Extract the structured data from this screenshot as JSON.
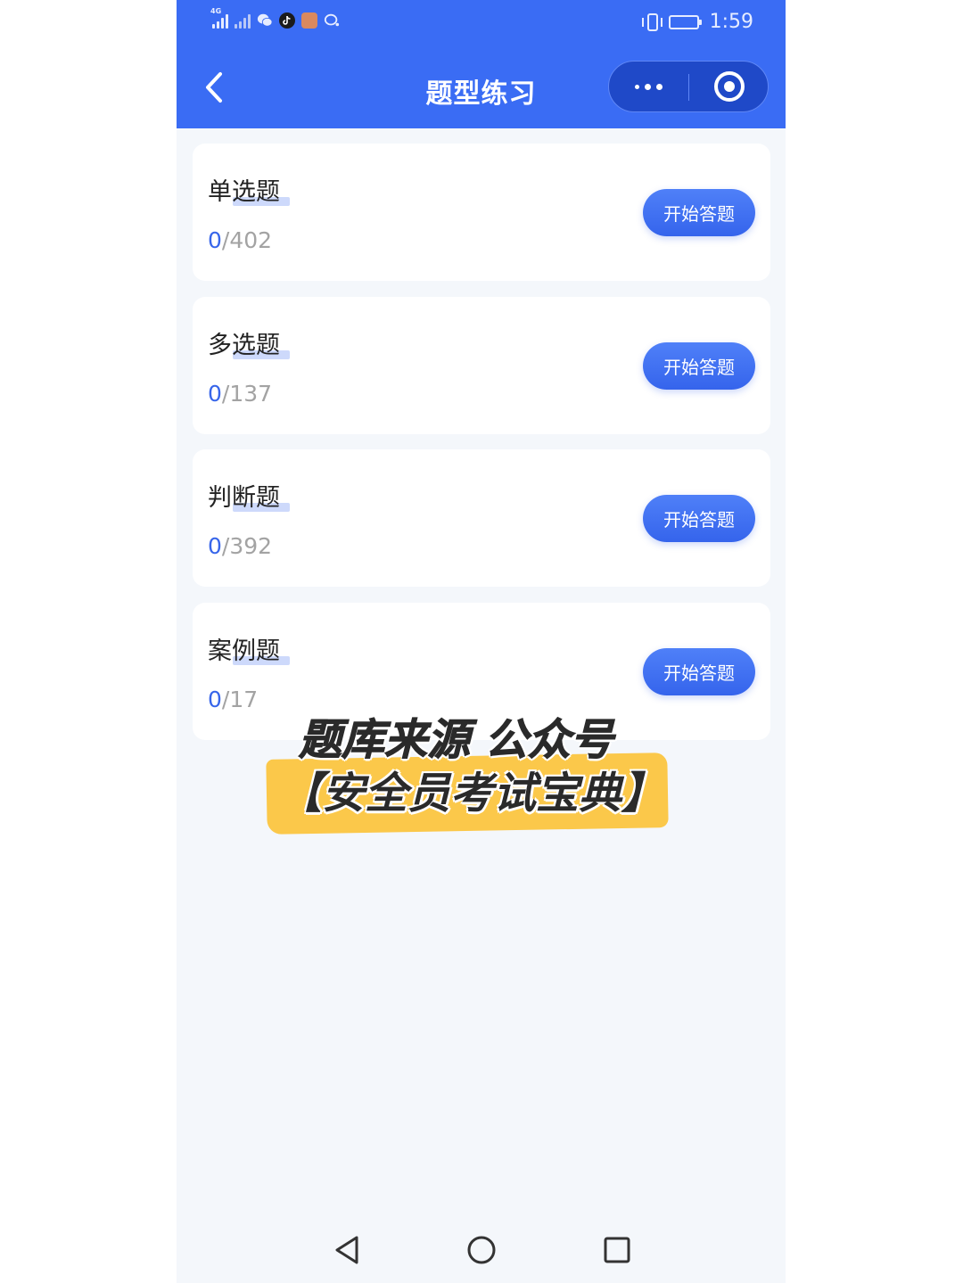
{
  "status_bar": {
    "network": "4G",
    "time": "1:59",
    "icons": [
      "signal-icon",
      "signal-no-sim-icon",
      "wechat-icon",
      "tiktok-icon",
      "app-icon",
      "chat-icon",
      "vibrate-icon",
      "battery-icon"
    ]
  },
  "nav": {
    "title": "题型练习",
    "back_icon": "chevron-left-icon",
    "more_icon": "more-dots-icon",
    "close_icon": "target-circle-icon"
  },
  "cards": [
    {
      "title": "单选题",
      "done": "0",
      "total": "/402",
      "button": "开始答题"
    },
    {
      "title": "多选题",
      "done": "0",
      "total": "/137",
      "button": "开始答题"
    },
    {
      "title": "判断题",
      "done": "0",
      "total": "/392",
      "button": "开始答题"
    },
    {
      "title": "案例题",
      "done": "0",
      "total": "/17",
      "button": "开始答题"
    }
  ],
  "overlay": {
    "line1": "题库来源 公众号",
    "line2": "【安全员考试宝典】"
  },
  "colors": {
    "primary": "#3a6cf4",
    "button": "#3866ea",
    "highlight": "#fbc84a",
    "background": "#f4f7fb"
  }
}
